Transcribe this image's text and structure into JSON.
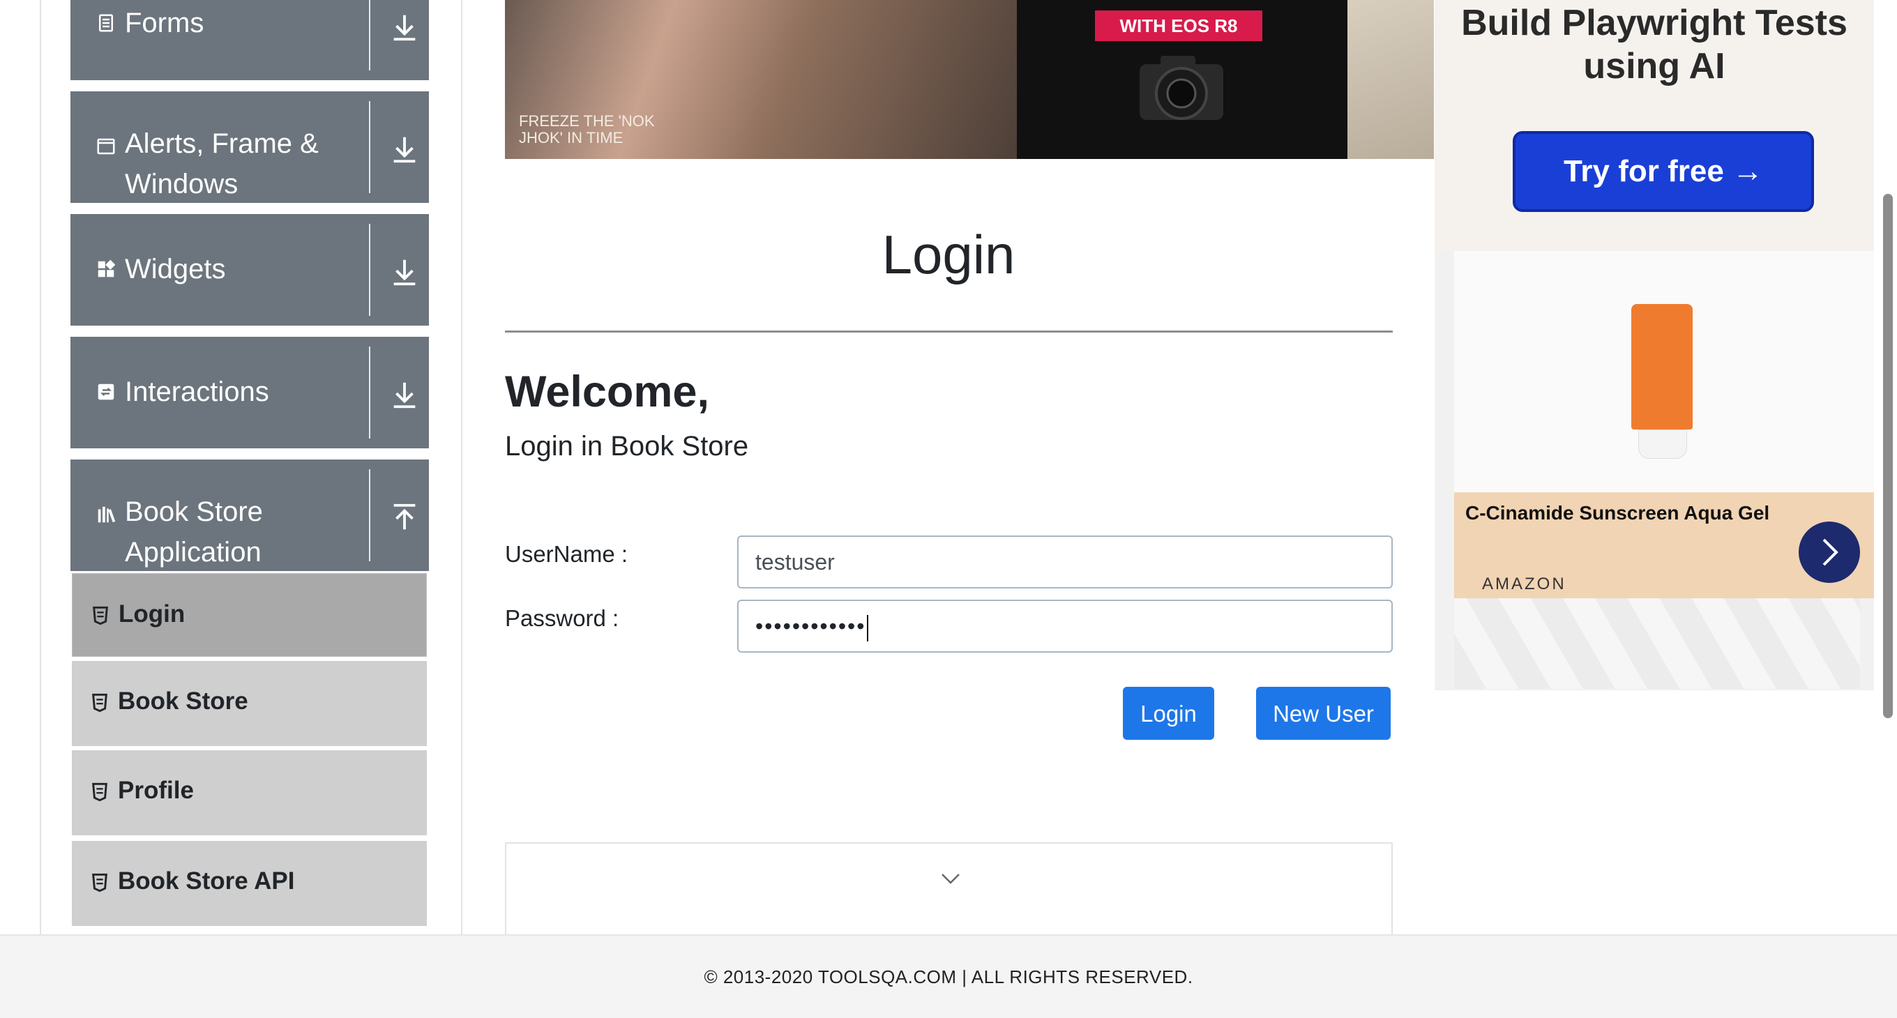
{
  "sidebar": {
    "groups": [
      {
        "label": "Forms",
        "icon": "form-icon",
        "arrow": "download-arrow-icon"
      },
      {
        "label": "Alerts, Frame &",
        "label2": "Windows",
        "icon": "window-icon",
        "arrow": "download-arrow-icon"
      },
      {
        "label": "Widgets",
        "icon": "widgets-icon",
        "arrow": "download-arrow-icon"
      },
      {
        "label": "Interactions",
        "icon": "interactions-icon",
        "arrow": "download-arrow-icon"
      },
      {
        "label": "Book Store",
        "label2": "Application",
        "icon": "books-icon",
        "arrow": "upload-arrow-icon"
      }
    ],
    "items": [
      {
        "label": "Login",
        "active": true
      },
      {
        "label": "Book Store"
      },
      {
        "label": "Profile"
      },
      {
        "label": "Book Store API"
      }
    ]
  },
  "banner": {
    "tagline": "FREEZE THE 'NOK JHOK' IN TIME",
    "with_text": "WITH",
    "camera_model": "EOS R8"
  },
  "main": {
    "title": "Login",
    "welcome": "Welcome,",
    "subtitle": "Login in Book Store",
    "username_label": "UserName :",
    "username_value": "testuser",
    "password_label": "Password :",
    "password_value": "••••••••••••",
    "login_button": "Login",
    "new_user_button": "New User"
  },
  "ads": {
    "top_heading": "Build Playwright Tests using AI",
    "top_cta": "Try for free →",
    "product_name": "C-Cinamide Sunscreen Aqua Gel",
    "product_brand": "AMAZON"
  },
  "footer": {
    "text": "© 2013-2020 TOOLSQA.COM | ALL RIGHTS RESERVED."
  },
  "colors": {
    "sidebar_group_bg": "#6c757d",
    "sidebar_item_bg": "#cfcfcf",
    "sidebar_item_active_bg": "#a9a9a9",
    "primary_button": "#1e77e8",
    "ad_cta": "#1a3fd6"
  }
}
